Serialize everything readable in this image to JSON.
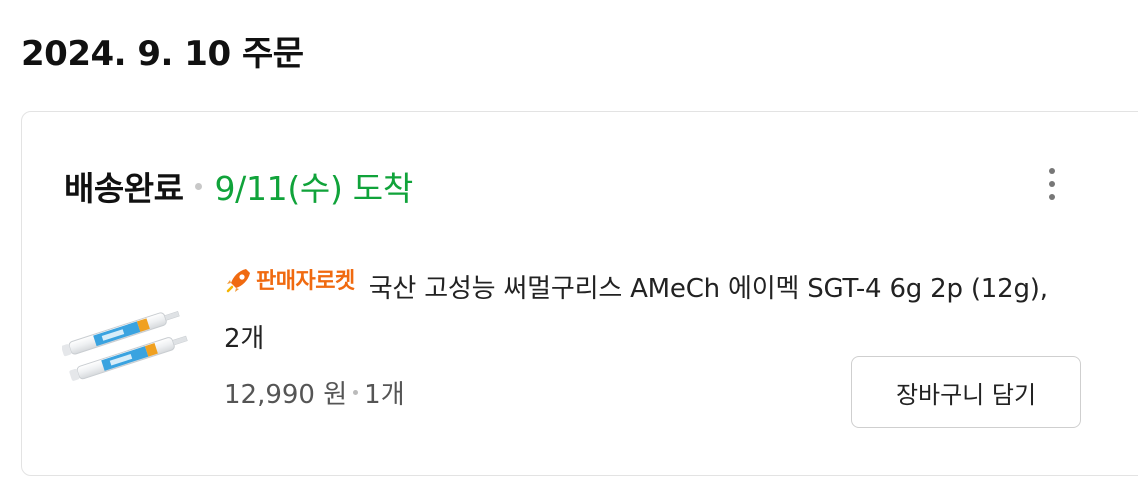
{
  "order": {
    "date_title": "2024. 9. 10 주문"
  },
  "shipment": {
    "status": "배송완료",
    "arrival": "9/11(수) 도착",
    "status_color": "#10a33a"
  },
  "product": {
    "seller_badge": "판매자로켓",
    "seller_badge_color": "#f06a10",
    "badge_icon": "rocket-icon",
    "title": "국산 고성능 써멀구리스 AMeCh 에이멕 SGT-4 6g 2p (12g), 2개",
    "price": "12,990 원",
    "quantity": "1개",
    "thumbnail_icon": "thermal-grease-syringe-image"
  },
  "actions": {
    "add_to_cart_label": "장바구니 담기",
    "more_icon": "more-vertical-icon"
  }
}
